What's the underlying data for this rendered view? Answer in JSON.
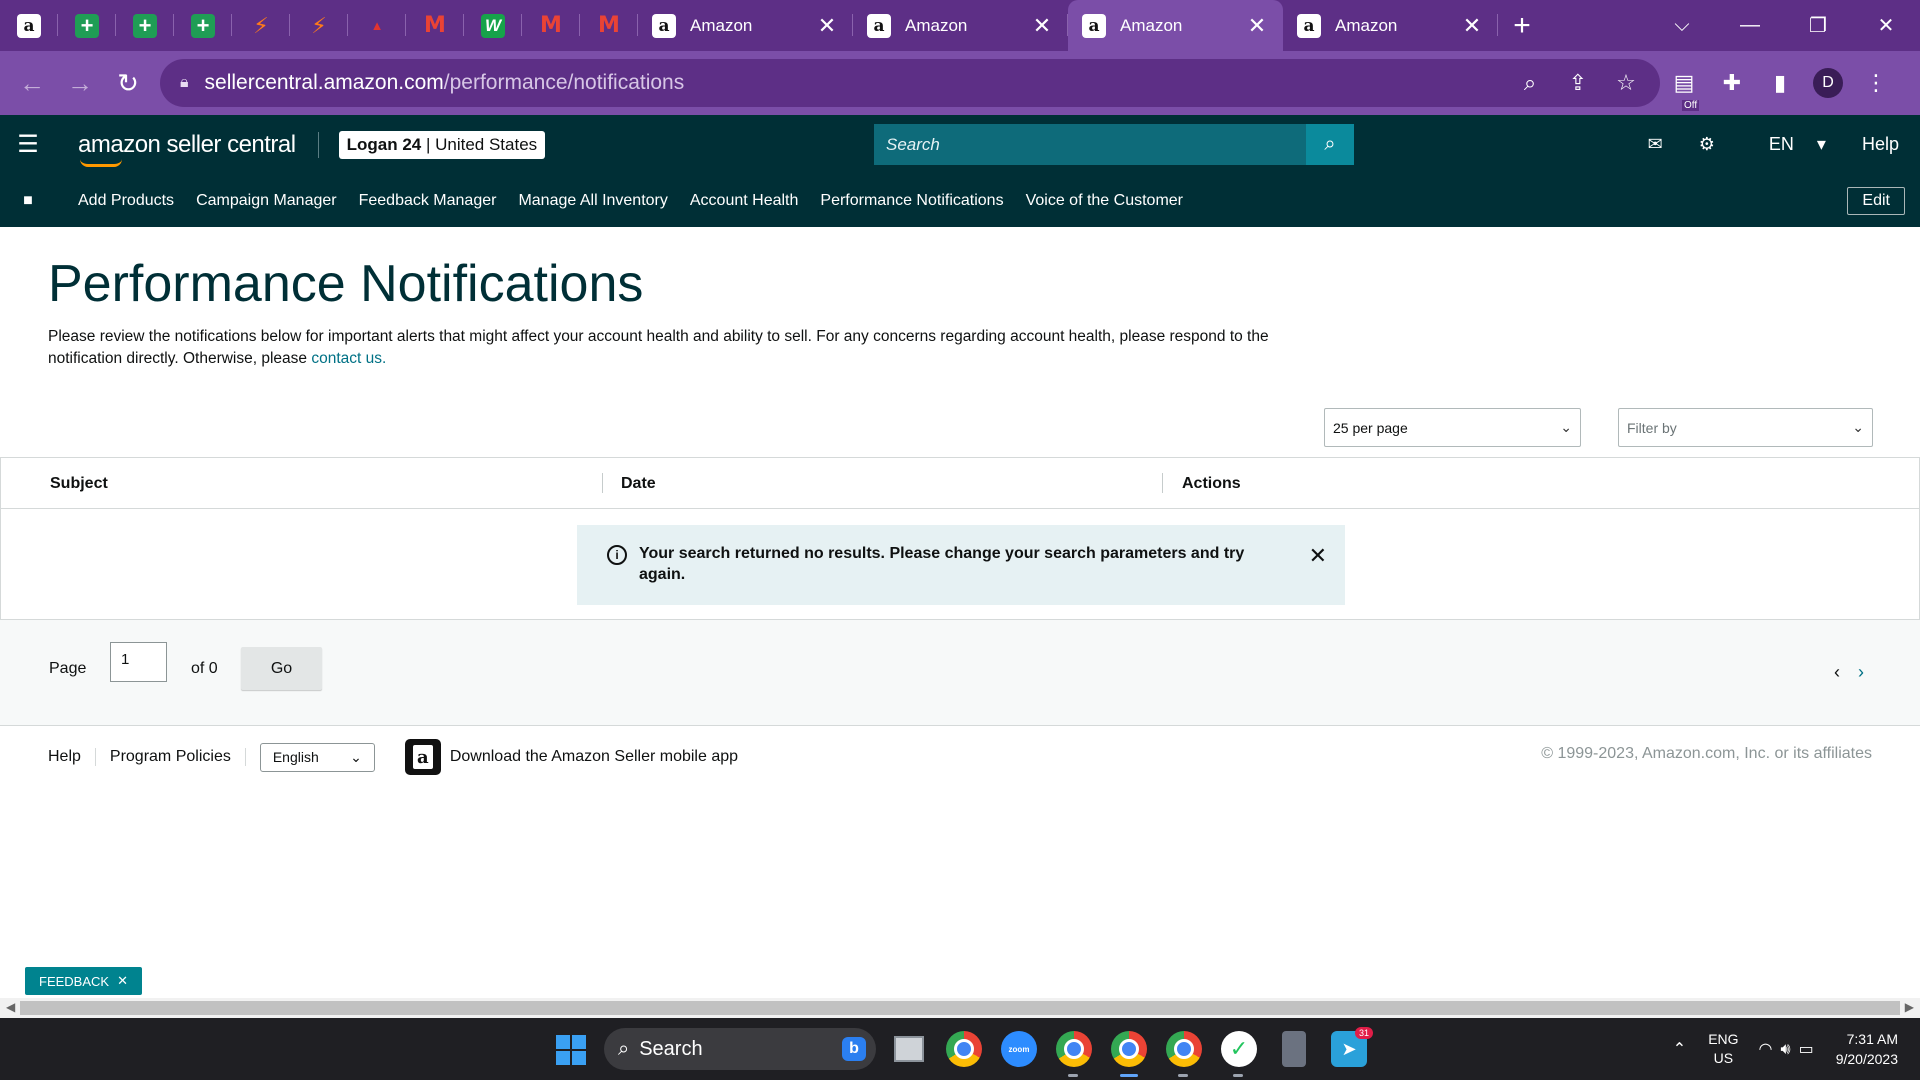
{
  "browser": {
    "pinned_tabs": [
      {
        "icon": "amazon-icon",
        "glyph": "a"
      },
      {
        "icon": "sheets-plus-icon",
        "glyph": "+"
      },
      {
        "icon": "sheets-plus-icon",
        "glyph": "+"
      },
      {
        "icon": "sheets-plus-icon",
        "glyph": "+"
      },
      {
        "icon": "zapier-icon",
        "glyph": "⚡"
      },
      {
        "icon": "zapier-icon",
        "glyph": "⚡"
      },
      {
        "icon": "red-logo-icon",
        "glyph": "▲"
      },
      {
        "icon": "gmail-icon",
        "glyph": "M"
      },
      {
        "icon": "w-app-icon",
        "glyph": "W"
      },
      {
        "icon": "gmail-icon",
        "glyph": "M"
      },
      {
        "icon": "gmail-icon",
        "glyph": "M"
      }
    ],
    "tabs": [
      {
        "title": "Amazon",
        "close": "✕"
      },
      {
        "title": "Amazon",
        "close": "✕"
      },
      {
        "title": "Amazon",
        "close": "✕"
      },
      {
        "title": "Amazon",
        "close": "✕"
      }
    ],
    "active_tab_index": 2,
    "new_tab": "+",
    "url_host": "sellercentral.amazon.com",
    "url_path": "/performance/notifications",
    "profile_initial": "D",
    "extension_badge": "Off"
  },
  "header": {
    "logo_text": "amazon seller central",
    "account_name": "Logan 24",
    "account_region": "United States",
    "search_placeholder": "Search",
    "language": "EN",
    "help": "Help"
  },
  "nav": {
    "links": [
      "Add Products",
      "Campaign Manager",
      "Feedback Manager",
      "Manage All Inventory",
      "Account Health",
      "Performance Notifications",
      "Voice of the Customer"
    ],
    "edit": "Edit"
  },
  "main": {
    "title": "Performance Notifications",
    "description": "Please review the notifications below for important alerts that might affect your account health and ability to sell. For any concerns regarding account health, please respond to the notification directly. Otherwise, please",
    "contact_link": "contact us.",
    "per_page": "25 per page",
    "filter_placeholder": "Filter by",
    "columns": [
      "Subject",
      "Date",
      "Actions"
    ],
    "empty_message": "Your search returned no results. Please change your search parameters and try again."
  },
  "pagination": {
    "page_label": "Page",
    "page_value": "1",
    "of_label": "of 0",
    "go": "Go"
  },
  "footer": {
    "help": "Help",
    "policies": "Program Policies",
    "language": "English",
    "app_text": "Download the Amazon Seller mobile app",
    "copyright": "© 1999-2023, Amazon.com, Inc. or its affiliates"
  },
  "feedback": {
    "label": "FEEDBACK",
    "close": "✕"
  },
  "taskbar": {
    "search": "Search",
    "telegram_badge": "31",
    "lang_line1": "ENG",
    "lang_line2": "US",
    "time": "7:31 AM",
    "date": "9/20/2023"
  }
}
